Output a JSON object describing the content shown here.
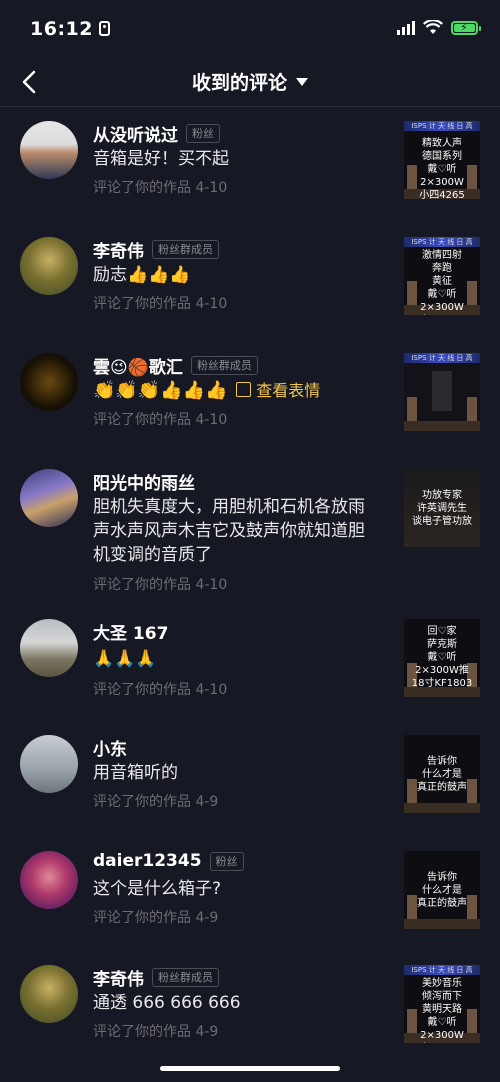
{
  "status_bar": {
    "time": "16:12"
  },
  "nav": {
    "title": "收到的评论"
  },
  "comments": [
    {
      "name": "从没听说过",
      "badge": "粉丝",
      "text": "音箱是好！买不起",
      "meta": "评论了你的作品  4-10",
      "thumb_text": "精致人声\n德国系列\n戴♡听\n2×300W\n小四4265"
    },
    {
      "name": "李奇伟",
      "badge": "粉丝群成员",
      "text": "励志👍👍👍",
      "meta": "评论了你的作品  4-10",
      "thumb_text": "激情四射\n奔跑\n黄征\n戴♡听\n2×300W\n小四4265"
    },
    {
      "name": "雲😉🏀歌汇",
      "badge": "粉丝群成员",
      "text": "👏👏👏👍👍👍",
      "link": "查看表情",
      "meta": "评论了你的作品  4-10",
      "thumb_text": ""
    },
    {
      "name": "阳光中的雨丝",
      "badge": "",
      "text": "胆机失真度大，用胆机和石机各放雨声水声风声木吉它及鼓声你就知道胆机变调的音质了",
      "meta": "评论了你的作品  4-10",
      "thumb_text": "功放专家\n许英调先生\n谈电子管功放"
    },
    {
      "name": "大圣 167",
      "badge": "",
      "text": "🙏🙏🙏",
      "meta": "评论了你的作品  4-10",
      "thumb_text": "回♡家\n萨克斯\n戴♡听\n2×300W推\n18寸KF1803"
    },
    {
      "name": "小东",
      "badge": "",
      "text": "用音箱听的",
      "meta": "评论了你的作品  4-9",
      "thumb_text": "告诉你\n什么才是\n真正的鼓声"
    },
    {
      "name": "daier12345",
      "badge": "粉丝",
      "text": "这个是什么箱子?",
      "meta": "评论了你的作品  4-9",
      "thumb_text": "告诉你\n什么才是\n真正的鼓声"
    },
    {
      "name": "李奇伟",
      "badge": "粉丝群成员",
      "text": "通透 666 666 666",
      "meta": "评论了你的作品  4-9",
      "thumb_text": "美妙音乐\n倾泻而下\n黄明天路\n戴♡听\n2×300W\n小四4265"
    }
  ]
}
